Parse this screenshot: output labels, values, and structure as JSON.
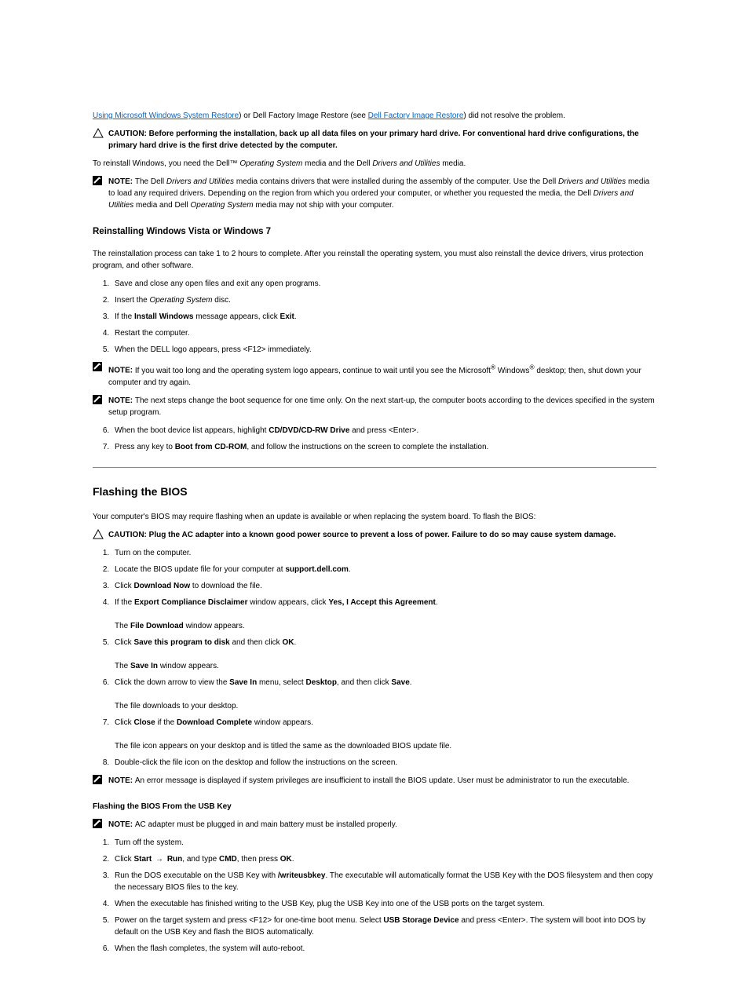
{
  "section1": {
    "heading": "Reinstalling Windows Vista or Windows 7",
    "para1_pre": "The reinstallation process can take 1 to 2 hours to complete. After you reinstall the operating system, you must also reinstall the device drivers, virus protection program, and other software.",
    "steps": [
      "Save and close any open files and exit any open programs.",
      "Insert the <span class=\"italic\">Operating System</span> disc.",
      "If the <span class=\"bold\">Install Windows</span> message appears, click <span class=\"bold\">Exit</span>.",
      "Restart the computer.",
      "When the DELL logo appears, press &lt;F12&gt; immediately."
    ],
    "link1": "Using Microsoft Windows System Restore",
    "dfr1_text": ") or Dell Factory Image Restore (see ",
    "link2": "Dell Factory Image Restore",
    "dfr2_text": ") did not resolve the problem.",
    "caution_label": "CAUTION: ",
    "caution_full": "Before performing the installation, back up all data files on your primary hard drive. For conventional hard drive configurations, the primary hard drive is the first drive detected by the computer.",
    "reinstall_pre": "To reinstall Windows, you need the Dell™ ",
    "reinstall_os": "Operating System",
    "reinstall_mid": " media and the Dell ",
    "reinstall_du": "Drivers and Utilities",
    "reinstall_post": " media.",
    "note_label": "NOTE: ",
    "note1": "The Dell <span class=\"italic\">Drivers and Utilities</span> media contains drivers that were installed during the assembly of the computer. Use the Dell <span class=\"italic\">Drivers and Utilities</span> media to load any required drivers. Depending on the region from which you ordered your computer, or whether you requested the media, the Dell <span class=\"italic\">Drivers and Utilities</span> media and Dell <span class=\"italic\">Operating System</span> media may not ship with your computer.",
    "note2": "If you wait too long and the operating system logo appears, continue to wait until you see the Microsoft<sup>®</sup> Windows<sup>®</sup> desktop; then, shut down your computer and try again.",
    "note3": "The next steps change the boot sequence for one time only. On the next start-up, the computer boots according to the devices specified in the system setup program.",
    "steps2": [
      "When the boot device list appears, highlight <span class=\"bold\">CD/DVD/CD-RW Drive</span> and press &lt;Enter&gt;.",
      "Press any key to <span class=\"bold\">Boot from CD-ROM</span>, and follow the instructions on the screen to complete the installation."
    ]
  },
  "section2": {
    "title": "Flashing the BIOS",
    "intro1": "Your computer's BIOS may require flashing when an update is available or when replacing the system board. To flash the BIOS:",
    "caution_label": "CAUTION: ",
    "caution": "Plug the AC adapter into a known good power source to prevent a loss of power. Failure to do so may cause system damage.",
    "steps1": [
      "Turn on the computer.",
      "Locate the BIOS update file for your computer at <span class=\"bold\">support.dell.com</span>.",
      "Click <span class=\"bold\">Download Now</span> to download the file.",
      "If the <span class=\"bold\">Export Compliance Disclaimer</span> window appears, click <span class=\"bold\">Yes, I Accept this Agreement</span>.<br><br>The <span class=\"bold\">File Download</span> window appears.",
      "Click <span class=\"bold\">Save this program to disk</span> and then click <span class=\"bold\">OK</span>.<br><br>The <span class=\"bold\">Save In</span> window appears.",
      "Click the down arrow to view the <span class=\"bold\">Save In</span> menu, select <span class=\"bold\">Desktop</span>, and then click <span class=\"bold\">Save</span>.<br><br>The file downloads to your desktop.",
      "Click <span class=\"bold\">Close</span> if the <span class=\"bold\">Download Complete</span> window appears.<br><br>The file icon appears on your desktop and is titled the same as the downloaded BIOS update file.",
      "Double-click the file icon on the desktop and follow the instructions on the screen."
    ],
    "note_label": "NOTE: ",
    "note": "An error message is displayed if system privileges are insufficient to install the BIOS update. User must be administrator to run the executable.",
    "heading2": "Flashing the BIOS From the USB Key",
    "note2": "AC adapter must be plugged in and main battery must be installed properly.",
    "steps3": [
      "Turn off the system.",
      "Click <span class=\"bold\">Start</span> <span class=\"arrow\">→</span> <span class=\"bold\">Run</span>, and type <span class=\"bold\">CMD</span>, then press <span class=\"bold\">OK</span>.",
      "Run the DOS executable on the USB Key with <span class=\"bold\">/writeusbkey</span>. The executable will automatically format the USB Key with the DOS filesystem and then copy the necessary BIOS files to the key.",
      "When the executable has finished writing to the USB Key, plug the USB Key into one of the USB ports on the target system.",
      "Power on the target system and press &lt;F12&gt; for one-time boot menu. Select <span class=\"bold\">USB Storage Device</span> and press &lt;Enter&gt;. The system will boot into DOS by default on the USB Key and flash the BIOS automatically.",
      "When the flash completes, the system will auto-reboot."
    ]
  }
}
